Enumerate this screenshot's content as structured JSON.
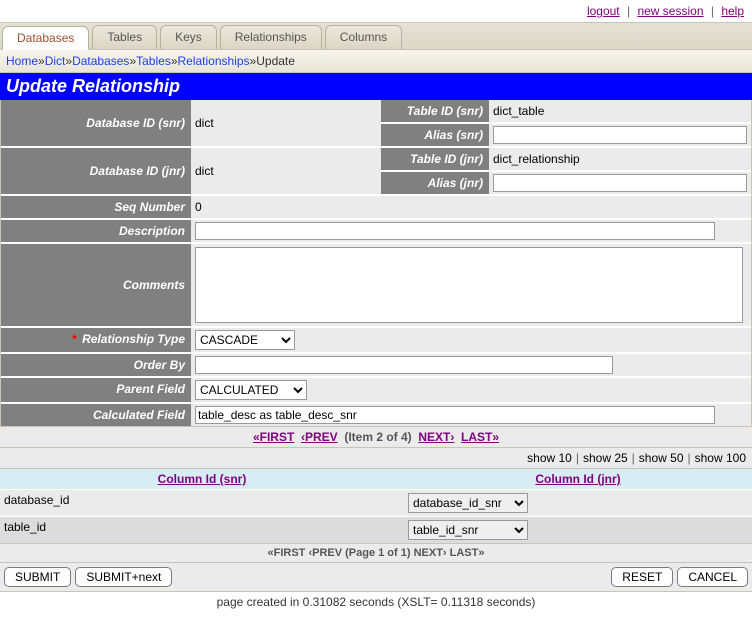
{
  "toplinks": {
    "logout": "logout",
    "newsession": "new session",
    "help": "help"
  },
  "tabs": [
    "Databases",
    "Tables",
    "Keys",
    "Relationships",
    "Columns"
  ],
  "breadcrumb": {
    "items": [
      "Home",
      "Dict",
      "Databases",
      "Tables",
      "Relationships"
    ],
    "current": "Update"
  },
  "title": "Update Relationship",
  "labels": {
    "db_snr": "Database ID (snr)",
    "db_jnr": "Database ID (jnr)",
    "table_snr": "Table ID (snr)",
    "alias_snr": "Alias (snr)",
    "table_jnr": "Table ID (jnr)",
    "alias_jnr": "Alias (jnr)",
    "seq": "Seq Number",
    "desc": "Description",
    "comments": "Comments",
    "reltype": "Relationship Type",
    "orderby": "Order By",
    "parentfield": "Parent Field",
    "calcfield": "Calculated Field"
  },
  "values": {
    "db_snr": "dict",
    "db_jnr": "dict",
    "table_snr": "dict_table",
    "alias_snr": "",
    "table_jnr": "dict_relationship",
    "alias_jnr": "",
    "seq": "0",
    "desc": "",
    "comments": "",
    "reltype": "CASCADE",
    "orderby": "",
    "parentfield": "CALCULATED",
    "calcfield": "table_desc as table_desc_snr"
  },
  "pager": {
    "first": "«FIRST",
    "prev": "‹PREV",
    "item": "(Item 2 of 4)",
    "next": "NEXT›",
    "last": "LAST»"
  },
  "showbar": {
    "s10": "show 10",
    "s25": "show 25",
    "s50": "show 50",
    "s100": "show 100"
  },
  "grid": {
    "head_snr": "Column Id (snr)",
    "head_jnr": "Column Id (jnr)",
    "rows": [
      {
        "snr": "database_id",
        "jnr": "database_id_snr"
      },
      {
        "snr": "table_id",
        "jnr": "table_id_snr"
      }
    ]
  },
  "pager2": "«FIRST  ‹PREV  (Page 1 of 1)  NEXT›  LAST»",
  "buttons": {
    "submit": "SUBMIT",
    "submitnext": "SUBMIT+next",
    "reset": "RESET",
    "cancel": "CANCEL"
  },
  "footer": "page created in 0.31082 seconds (XSLT= 0.11318 seconds)"
}
